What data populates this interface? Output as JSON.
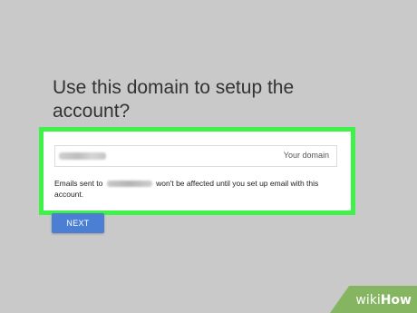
{
  "dialog": {
    "heading": "Use this domain to setup the account?"
  },
  "domain_input": {
    "suffix_label": "Your domain"
  },
  "notice": {
    "prefix": "Emails sent to",
    "suffix": "won't be affected until you set up email with this account."
  },
  "actions": {
    "next_label": "NEXT"
  },
  "watermark": {
    "wiki": "wiki",
    "how": "How"
  },
  "colors": {
    "page_background": "#c9c9c9",
    "highlight_border": "#3ef24a",
    "next_button": "#4a7fd4",
    "watermark_green": "#86b561"
  }
}
